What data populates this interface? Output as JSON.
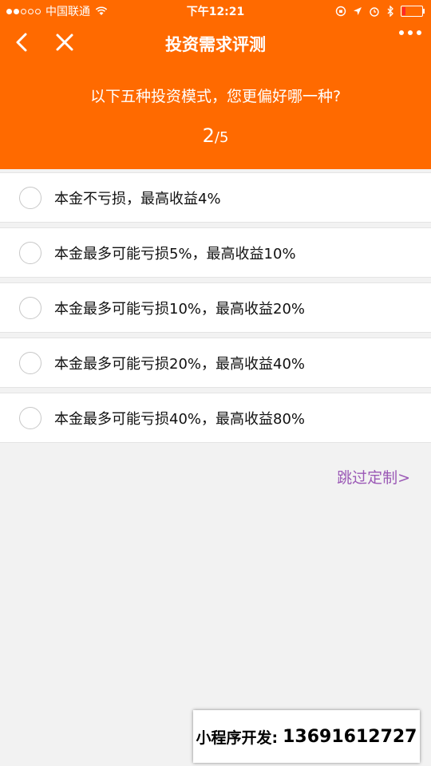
{
  "status_bar": {
    "carrier": "中国联通",
    "time": "下午12:21"
  },
  "nav": {
    "title": "投资需求评测",
    "back_icon": "chevron-left-icon",
    "close_icon": "close-icon",
    "more_icon": "more-icon"
  },
  "question": {
    "text": "以下五种投资模式，您更偏好哪一种?",
    "current": "2",
    "total": "/5"
  },
  "options": [
    {
      "label": "本金不亏损，最高收益4%"
    },
    {
      "label": "本金最多可能亏损5%，最高收益10%"
    },
    {
      "label": "本金最多可能亏损10%，最高收益20%"
    },
    {
      "label": "本金最多可能亏损20%，最高收益40%"
    },
    {
      "label": "本金最多可能亏损40%，最高收益80%"
    }
  ],
  "skip_link": "跳过定制>",
  "ad_banner": {
    "label": "小程序开发:",
    "phone": "13691612727"
  },
  "colors": {
    "accent": "#ff6a00",
    "link": "#9b59b6"
  }
}
